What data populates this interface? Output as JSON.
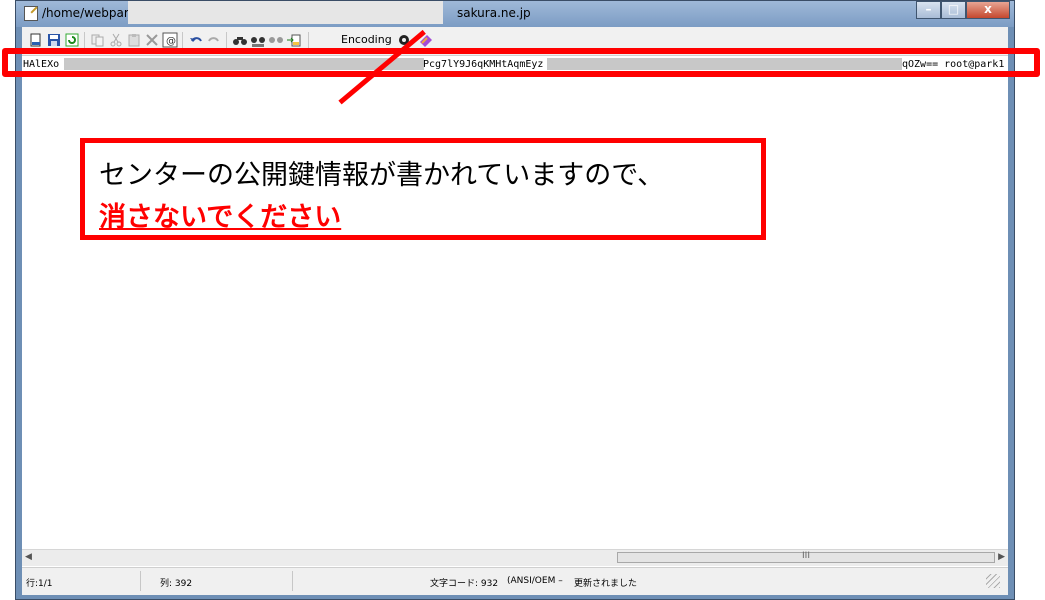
{
  "window": {
    "title_path": "/home/webpar",
    "title_host": "sakura.ne.jp",
    "buttons": {
      "minimize": "–",
      "maximize": "□",
      "close": "x"
    }
  },
  "toolbar": {
    "encoding_label": "Encoding",
    "icons": [
      "new-file-icon",
      "save-icon",
      "refresh-icon",
      "copy-icon",
      "cut-icon",
      "paste-icon",
      "delete-icon",
      "select-all-icon",
      "undo-icon",
      "redo-icon",
      "find-icon",
      "find-next-icon",
      "replace-icon",
      "goto-icon",
      "settings-icon",
      "help-icon"
    ]
  },
  "editor": {
    "line_start": "HAlEXo",
    "line_mid": "Pcg7lY9J6qKMHtAqmEyz",
    "line_end": "qOZw== root@park1"
  },
  "scrollbar": {
    "left_arrow": "◀",
    "right_arrow": "▶",
    "thumb_grip": "III"
  },
  "status": {
    "line": "行:1/1",
    "column": "列: 392",
    "charcode": "文字コード: 932",
    "encoding": "(ANSI/OEM –",
    "saved": "更新されました"
  },
  "callout": {
    "line1": "センターの公開鍵情報が書かれていますので、",
    "line2": "消さないでください"
  },
  "colors": {
    "annotation_red": "#ff0000",
    "titlebar": "#8aa8cd"
  }
}
